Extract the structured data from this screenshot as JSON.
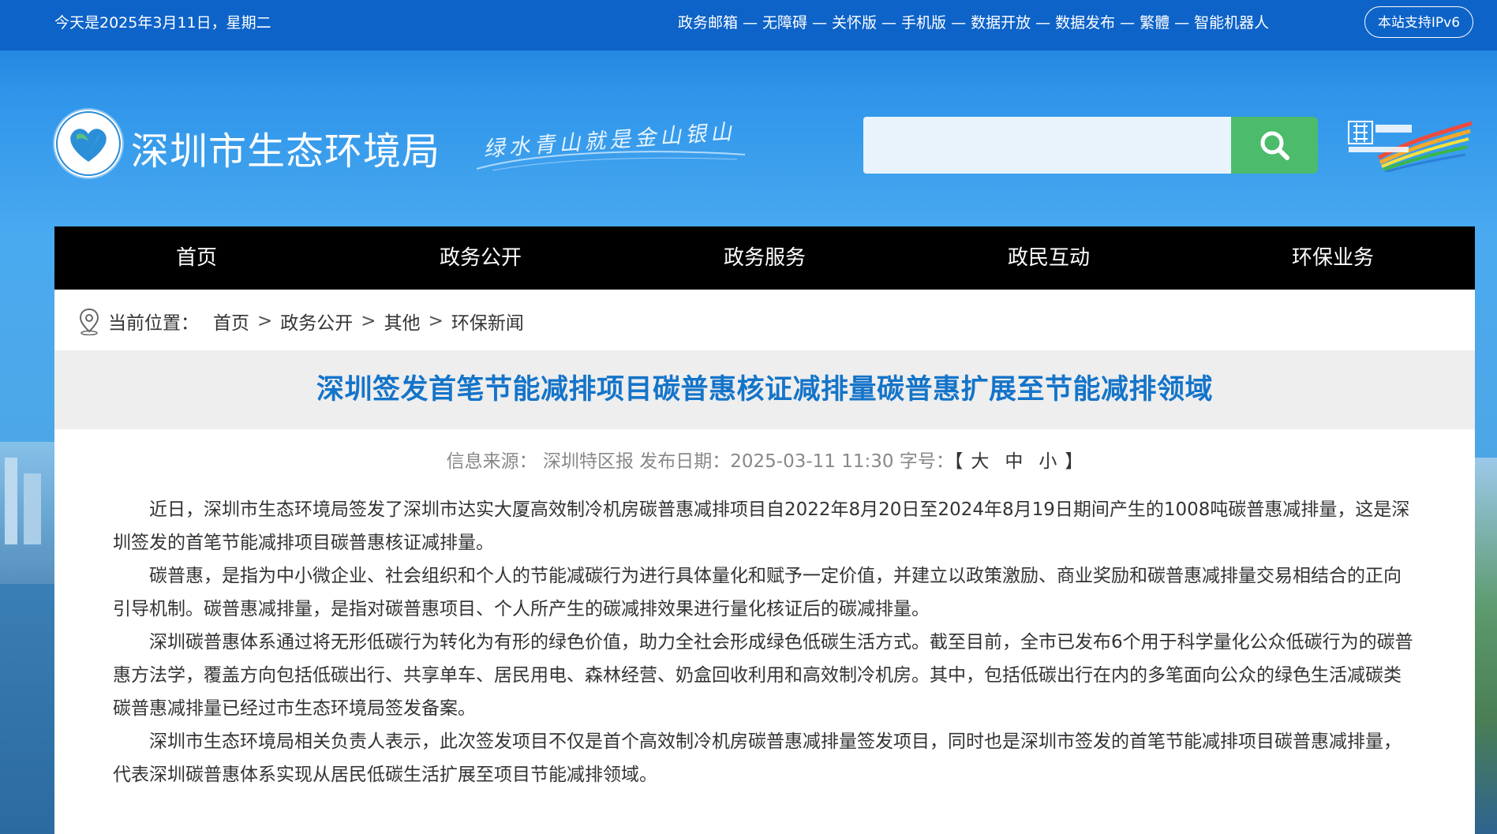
{
  "topbar": {
    "date_text": "今天是2025年3月11日，星期二",
    "links": [
      "政务邮箱",
      "无障碍",
      "关怀版",
      "手机版",
      "数据开放",
      "数据发布",
      "繁體",
      "智能机器人"
    ],
    "separator": "—",
    "ipv6_label": "本站支持IPv6"
  },
  "header": {
    "site_title": "深圳市生态环境局",
    "slogan": "绿水青山就是金山银山",
    "search_placeholder": "",
    "search_value": "",
    "brand_colors": {
      "topbar": "#0d63c8",
      "nav": "#000000",
      "search_button": "#4cbb6c",
      "title": "#1474c9"
    }
  },
  "nav": {
    "items": [
      "首页",
      "政务公开",
      "政务服务",
      "政民互动",
      "环保业务"
    ]
  },
  "breadcrumb": {
    "label": "当前位置：",
    "items": [
      "首页",
      "政务公开",
      "其他",
      "环保新闻"
    ],
    "separator": ">"
  },
  "article": {
    "title": "深圳签发首笔节能减排项目碳普惠核证减排量碳普惠扩展至节能减排领域",
    "source_label": "信息来源：",
    "source": "深圳特区报",
    "date_label": "发布日期：",
    "date": "2025-03-11 11:30",
    "fontsize_label": "字号：",
    "bracket_open": "【",
    "bracket_close": "】",
    "sizes": [
      "大",
      "中",
      "小"
    ],
    "paragraphs": [
      "近日，深圳市生态环境局签发了深圳市达实大厦高效制冷机房碳普惠减排项目自2022年8月20日至2024年8月19日期间产生的1008吨碳普惠减排量，这是深圳签发的首笔节能减排项目碳普惠核证减排量。",
      "碳普惠，是指为中小微企业、社会组织和个人的节能减碳行为进行具体量化和赋予一定价值，并建立以政策激励、商业奖励和碳普惠减排量交易相结合的正向引导机制。碳普惠减排量，是指对碳普惠项目、个人所产生的碳减排效果进行量化核证后的碳减排量。",
      "深圳碳普惠体系通过将无形低碳行为转化为有形的绿色价值，助力全社会形成绿色低碳生活方式。截至目前，全市已发布6个用于科学量化公众低碳行为的碳普惠方法学，覆盖方向包括低碳出行、共享单车、居民用电、森林经营、奶盒回收利用和高效制冷机房。其中，包括低碳出行在内的多笔面向公众的绿色生活减碳类碳普惠减排量已经过市生态环境局签发备案。",
      "深圳市生态环境局相关负责人表示，此次签发项目不仅是首个高效制冷机房碳普惠减排量签发项目，同时也是深圳市签发的首笔节能减排项目碳普惠减排量，代表深圳碳普惠体系实现从居民低碳生活扩展至项目节能减排领域。"
    ]
  },
  "icons": {
    "logo": "heart-emblem-icon",
    "search": "search-icon",
    "location": "location-pin-icon",
    "city_logo": "shenzhen-china-logo"
  }
}
